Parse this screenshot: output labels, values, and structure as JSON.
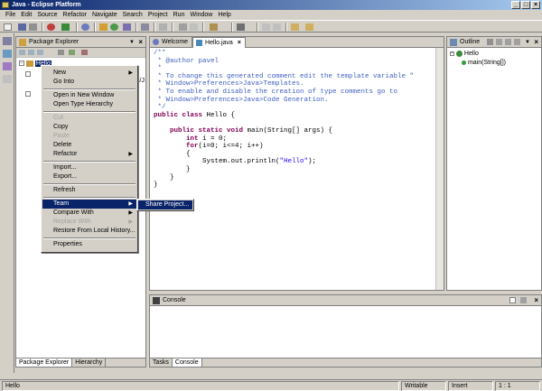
{
  "window": {
    "title": "Java - Eclipse Platform",
    "min": "_",
    "max": "□",
    "close": "×"
  },
  "menubar": [
    "File",
    "Edit",
    "Source",
    "Refactor",
    "Navigate",
    "Search",
    "Project",
    "Run",
    "Window",
    "Help"
  ],
  "package_explorer": {
    "title": "Package Explorer",
    "root": "Hello",
    "trunc_text": "s/J",
    "tabs": [
      "Package Explorer",
      "Hierarchy"
    ]
  },
  "context_menu": {
    "items": [
      {
        "label": "New",
        "submenu": true,
        "enabled": true
      },
      {
        "label": "Go Into",
        "enabled": true
      },
      {
        "sep": true
      },
      {
        "label": "Open in New Window",
        "enabled": true
      },
      {
        "label": "Open Type Hierarchy",
        "enabled": true
      },
      {
        "sep": true
      },
      {
        "label": "Cut",
        "enabled": false
      },
      {
        "label": "Copy",
        "enabled": true
      },
      {
        "label": "Paste",
        "enabled": false
      },
      {
        "label": "Delete",
        "enabled": true
      },
      {
        "label": "Refactor",
        "submenu": true,
        "enabled": true
      },
      {
        "sep": true
      },
      {
        "label": "Import...",
        "enabled": true
      },
      {
        "label": "Export...",
        "enabled": true
      },
      {
        "sep": true
      },
      {
        "label": "Refresh",
        "enabled": true
      },
      {
        "sep": true
      },
      {
        "label": "Team",
        "submenu": true,
        "enabled": true,
        "selected": true
      },
      {
        "label": "Compare With",
        "submenu": true,
        "enabled": true
      },
      {
        "label": "Replace With",
        "submenu": true,
        "enabled": false
      },
      {
        "label": "Restore From Local History...",
        "enabled": true
      },
      {
        "sep": true
      },
      {
        "label": "Properties",
        "enabled": true
      }
    ],
    "team_submenu": [
      "Share Project..."
    ]
  },
  "editor": {
    "tabs": [
      "Welcome",
      "Hello.java"
    ],
    "active_tab": "Hello.java",
    "close": "×",
    "code": {
      "c0": "/**",
      "c1": " * @author pavel",
      "c2": " *",
      "c3": " * To change this generated comment edit the template variable \"",
      "c4": " * Window>Preferences>Java>Templates.",
      "c5": " * To enable and disable the creation of type comments go to",
      "c6": " * Window>Preferences>Java>Code Generation.",
      "c7": " */",
      "l8_kw": "public class",
      "l8_rest": " Hello {",
      "l9_kw": "    public static void",
      "l9_rest": " main(String[] args) {",
      "l10_kw": "        int",
      "l10_rest": " i = 0;",
      "l11_kw": "        for",
      "l11_rest": "(i=0; i<=4; i++)",
      "l12": "        {",
      "l13_pre": "            System.out.println(",
      "l13_str": "\"Hello\"",
      "l13_post": ");",
      "l14": "        }",
      "l15": "    }",
      "l16": "}"
    }
  },
  "outline": {
    "title": "Outline",
    "class_name": "Hello",
    "method": "main(String[])"
  },
  "console": {
    "title": "Console",
    "tabs": [
      "Tasks",
      "Console"
    ]
  },
  "statusbar": {
    "left": "Hello",
    "writable": "Writable",
    "insert": "Insert",
    "position": "1 : 1"
  },
  "colors": {
    "title_gradient_start": "#0a246a",
    "selection": "#0a246a",
    "comment": "#3f5fbf",
    "keyword": "#7f0055",
    "string": "#2a00ff"
  }
}
